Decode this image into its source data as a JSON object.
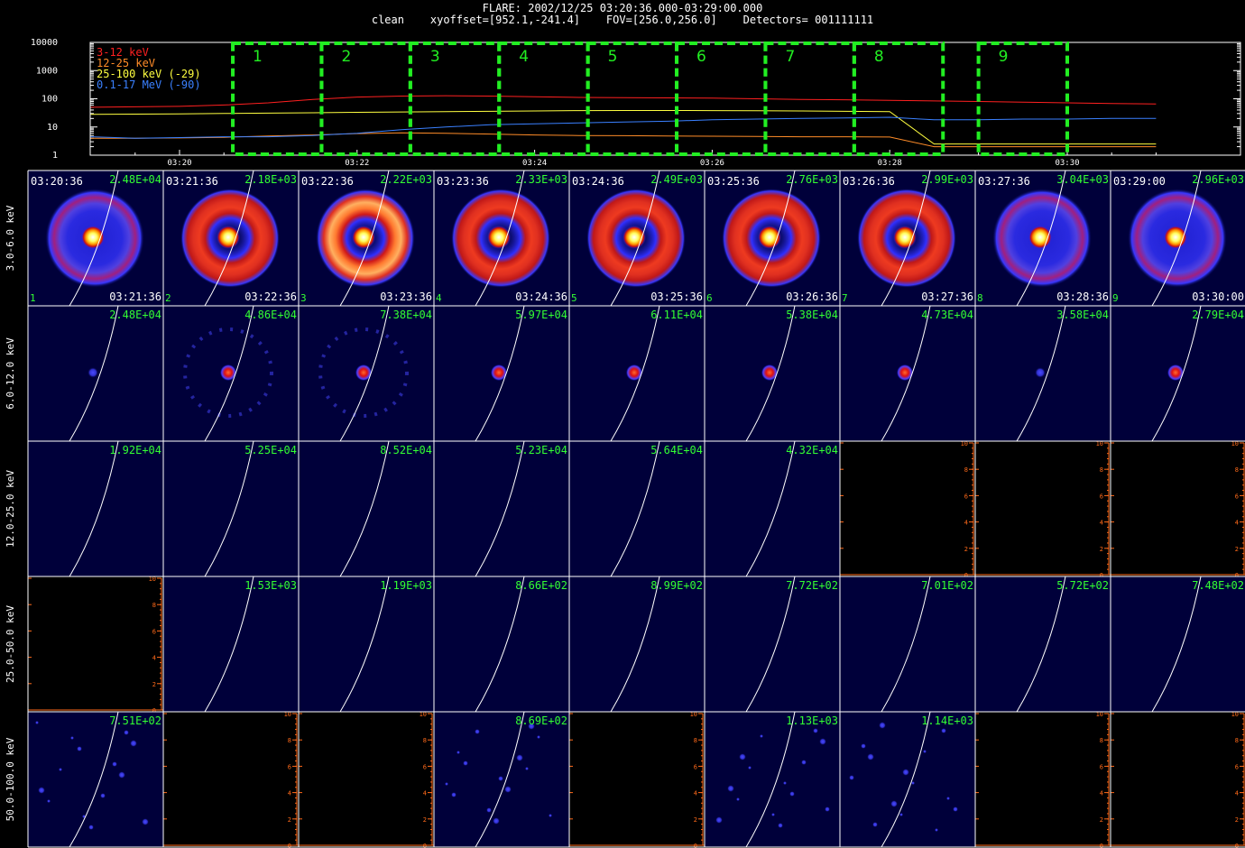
{
  "header": {
    "title_line1": "FLARE: 2002/12/25 03:20:36.000-03:29:00.000",
    "title_line2": "clean    xyoffset=[952.1,-241.4]    FOV=[256.0,256.0]    Detectors= 001111111"
  },
  "colors": {
    "background": "#000000",
    "cell_background": "#00003a",
    "limb": "#ffffff",
    "peak_label": "#33ff33",
    "interval_box": "#22ee22",
    "axis_orange": "#ff6a1a",
    "band_3_12": "#ff2020",
    "band_12_25": "#ff8c28",
    "band_25_100": "#ffff40",
    "band_01_17": "#3a80ff"
  },
  "chart_data": [
    {
      "type": "line",
      "title": "",
      "yscale": "log",
      "ylim": [
        1,
        10000
      ],
      "ytick_labels": [
        "1",
        "10",
        "100",
        "1000",
        "10000"
      ],
      "x_tick_labels": [
        "03:20",
        "03:22",
        "03:24",
        "03:26",
        "03:28",
        "03:30"
      ],
      "x_minutes": [
        0,
        1,
        2,
        3,
        4,
        5,
        6,
        7,
        8,
        9,
        10,
        11,
        12,
        13,
        14,
        15,
        16,
        17,
        18,
        19,
        20,
        21,
        22,
        23,
        24
      ],
      "x_start": "03:19:00",
      "legend": {
        "position": "top-left"
      },
      "series": [
        {
          "name": "3-12 keV",
          "color": "#ff2020",
          "values": [
            50,
            52,
            54,
            60,
            72,
            95,
            115,
            125,
            128,
            125,
            118,
            112,
            110,
            108,
            105,
            100,
            95,
            92,
            88,
            84,
            80,
            76,
            72,
            68,
            65
          ]
        },
        {
          "name": "12-25 keV",
          "color": "#ff8c28",
          "values": [
            4,
            4,
            4.1,
            4.3,
            4.8,
            5.2,
            5.8,
            6.2,
            6.0,
            5.6,
            5.2,
            5.0,
            4.9,
            4.8,
            4.7,
            4.6,
            4.5,
            4.5,
            4.4,
            2.0,
            2.0,
            2.0,
            2.0,
            2.0,
            2.0
          ]
        },
        {
          "name": "25-100 keV (-29)",
          "color": "#ffff40",
          "values": [
            28,
            28.5,
            29,
            30,
            31,
            32,
            33,
            34,
            35,
            36,
            37,
            38,
            38.5,
            38.5,
            38,
            37.5,
            37,
            36,
            35,
            2.5,
            2.5,
            2.5,
            2.5,
            2.5,
            2.5
          ]
        },
        {
          "name": "0.1-17 MeV (-90)",
          "color": "#3a80ff",
          "values": [
            4.5,
            4,
            4.2,
            4.5,
            4.5,
            5,
            6,
            8,
            10,
            12,
            13,
            14,
            15,
            16,
            18,
            19,
            20,
            21,
            22,
            18,
            18,
            19,
            19,
            20,
            20
          ]
        }
      ],
      "intervals": [
        {
          "label": "1",
          "start": "03:20:36",
          "end": "03:21:36"
        },
        {
          "label": "2",
          "start": "03:21:36",
          "end": "03:22:36"
        },
        {
          "label": "3",
          "start": "03:22:36",
          "end": "03:23:36"
        },
        {
          "label": "4",
          "start": "03:23:36",
          "end": "03:24:36"
        },
        {
          "label": "5",
          "start": "03:24:36",
          "end": "03:25:36"
        },
        {
          "label": "6",
          "start": "03:25:36",
          "end": "03:26:36"
        },
        {
          "label": "7",
          "start": "03:26:36",
          "end": "03:27:36"
        },
        {
          "label": "8",
          "start": "03:27:36",
          "end": "03:28:36"
        },
        {
          "label": "9",
          "start": "03:29:00",
          "end": "03:30:00"
        }
      ]
    },
    {
      "type": "heatmap",
      "title": "",
      "row_labels": [
        "3.0-6.0 keV",
        "6.0-12.0 keV",
        "12.0-25.0 keV",
        "25.0-50.0 keV",
        "50.0-100.0 keV"
      ],
      "start_times": [
        "03:20:36",
        "03:21:36",
        "03:22:36",
        "03:23:36",
        "03:24:36",
        "03:25:36",
        "03:26:36",
        "03:27:36",
        "03:29:00"
      ],
      "end_times": [
        "03:21:36",
        "03:22:36",
        "03:23:36",
        "03:24:36",
        "03:25:36",
        "03:26:36",
        "03:27:36",
        "03:28:36",
        "03:30:00"
      ],
      "interval_numbers": [
        "1",
        "2",
        "3",
        "4",
        "5",
        "6",
        "7",
        "8",
        "9"
      ],
      "empty_axis_ticks": [
        "0",
        "2",
        "4",
        "6",
        "8",
        "10"
      ],
      "peaks": [
        [
          "2.48E+04",
          "2.18E+03",
          "2.22E+03",
          "2.33E+03",
          "2.49E+03",
          "2.76E+03",
          "2.99E+03",
          "3.04E+03",
          "2.96E+03"
        ],
        [
          "2.48E+04",
          "4.86E+04",
          "7.38E+04",
          "5.97E+04",
          "6.11E+04",
          "5.38E+04",
          "4.73E+04",
          "3.58E+04",
          "2.79E+04"
        ],
        [
          "1.92E+04",
          "5.25E+04",
          "8.52E+04",
          "5.23E+04",
          "5.64E+04",
          "4.32E+04",
          null,
          null,
          null
        ],
        [
          null,
          "1.53E+03",
          "1.19E+03",
          "8.66E+02",
          "8.99E+02",
          "7.72E+02",
          "7.01E+02",
          "5.72E+02",
          "7.48E+02"
        ],
        [
          "7.51E+02",
          null,
          null,
          "8.69E+02",
          null,
          "1.13E+03",
          "1.14E+03",
          null,
          null
        ]
      ]
    }
  ]
}
